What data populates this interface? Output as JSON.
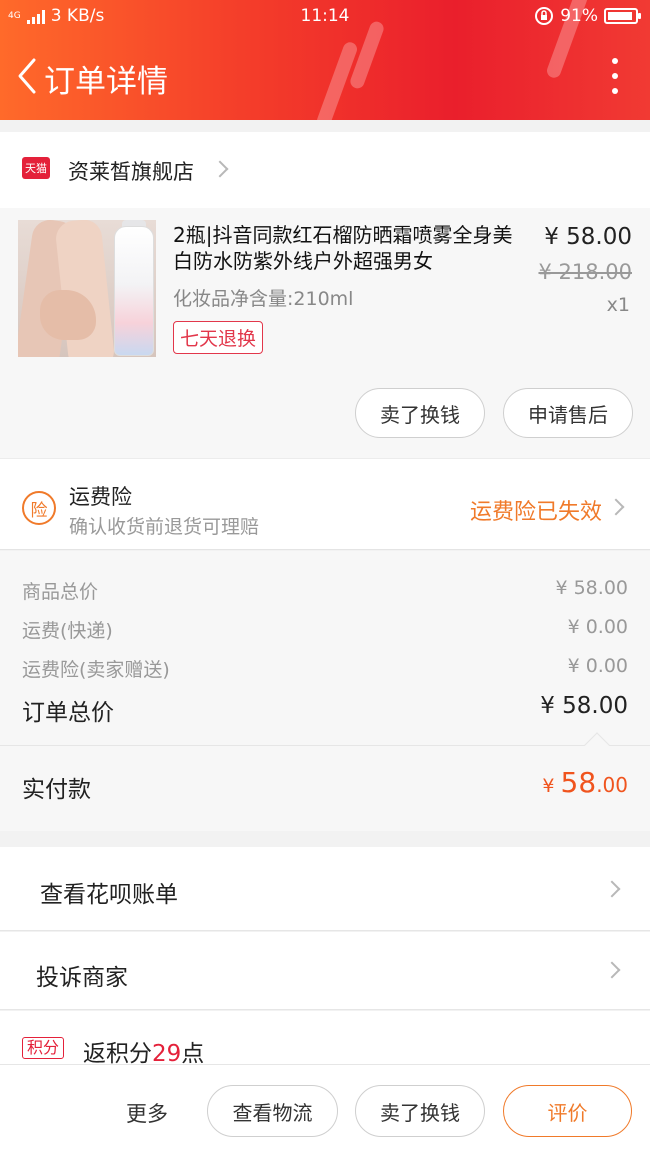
{
  "status_bar": {
    "network": "4G",
    "speed": "3 KB/s",
    "time": "11:14",
    "battery": "91%"
  },
  "nav": {
    "title": "订单详情"
  },
  "store": {
    "badge": "天猫",
    "name": "资莱皙旗舰店"
  },
  "product": {
    "title": "2瓶|抖音同款红石榴防晒霜喷雾全身美白防水防紫外线户外超强男女",
    "spec": "化妆品净含量:210ml",
    "tag": "七天退换",
    "price": "¥ 58.00",
    "original_price": "¥ 218.00",
    "quantity": "x1",
    "buttons": {
      "sell": "卖了换钱",
      "after_sale": "申请售后"
    }
  },
  "insurance": {
    "icon_text": "险",
    "title": "运费险",
    "subtitle": "确认收货前退货可理赔",
    "status": "运费险已失效"
  },
  "summary": {
    "rows": [
      {
        "label": "商品总价",
        "value": "¥ 58.00"
      },
      {
        "label": "运费(快递)",
        "value": "¥ 0.00"
      },
      {
        "label": "运费险(卖家赠送)",
        "value": "¥ 0.00"
      }
    ],
    "total_label": "订单总价",
    "total_value": "¥ 58.00",
    "paid_label": "实付款",
    "paid_currency": "¥ ",
    "paid_integer": "58",
    "paid_decimal": ".00"
  },
  "actions": {
    "huabei": "查看花呗账单",
    "complain": "投诉商家"
  },
  "points": {
    "badge": "积分",
    "prefix": "返积分",
    "number": "29",
    "suffix": "点"
  },
  "bottom_bar": {
    "more": "更多",
    "logistics": "查看物流",
    "sell": "卖了换钱",
    "review": "评价"
  },
  "colors": {
    "header_red": "#ea1f2c",
    "accent_orange": "#f07a2a",
    "tmall_red": "#e4213a"
  }
}
